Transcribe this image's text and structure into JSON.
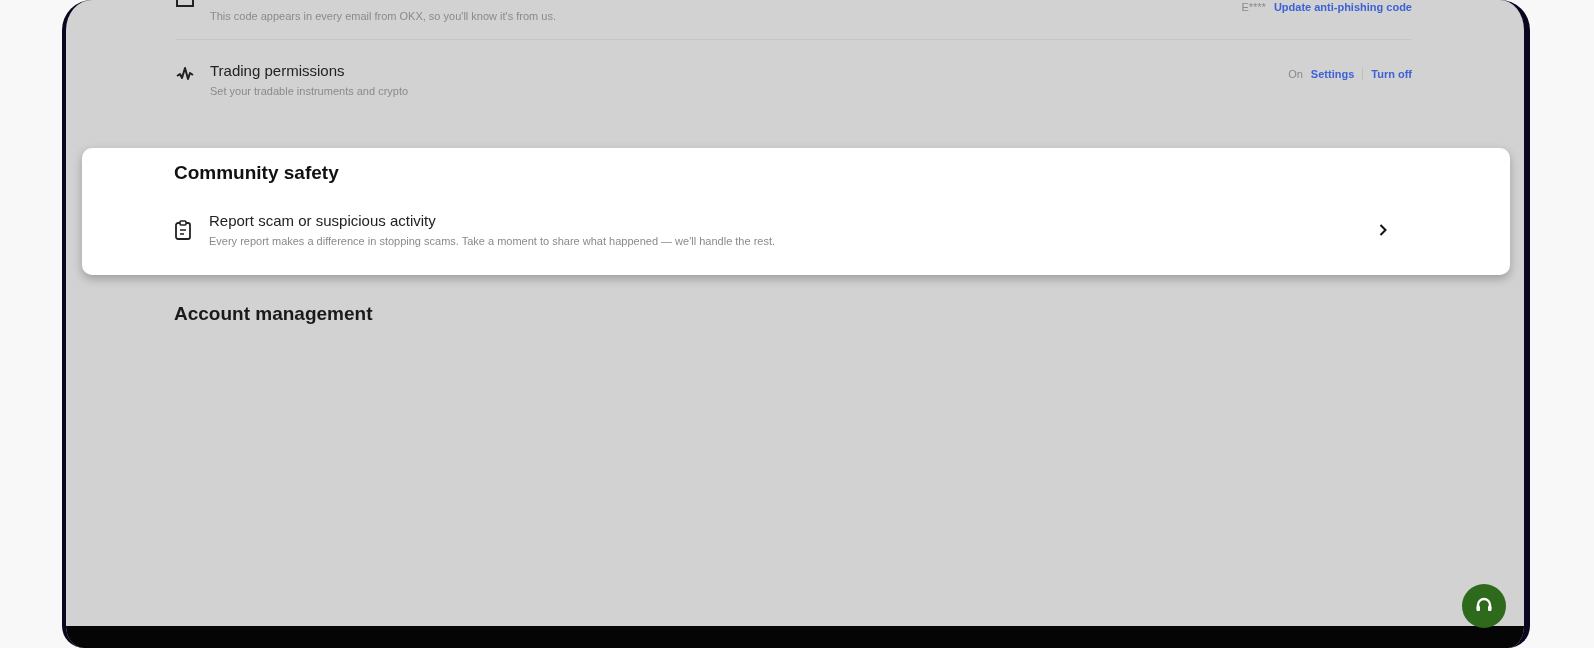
{
  "security_rows": [
    {
      "description": "This code appears in every email from OKX, so you'll know it's from us.",
      "value": "E****",
      "actions": [
        "Update anti-phishing code"
      ]
    },
    {
      "title": "Trading permissions",
      "description": "Set your tradable instruments and crypto",
      "value": "On",
      "actions": [
        "Settings",
        "Turn off"
      ]
    }
  ],
  "community_safety": {
    "heading": "Community safety",
    "items": [
      {
        "title": "Report scam or suspicious activity",
        "description": "Every report makes a difference in stopping scams. Take a moment to share what happened — we'll handle the rest."
      }
    ]
  },
  "account_management": {
    "heading": "Account management"
  }
}
